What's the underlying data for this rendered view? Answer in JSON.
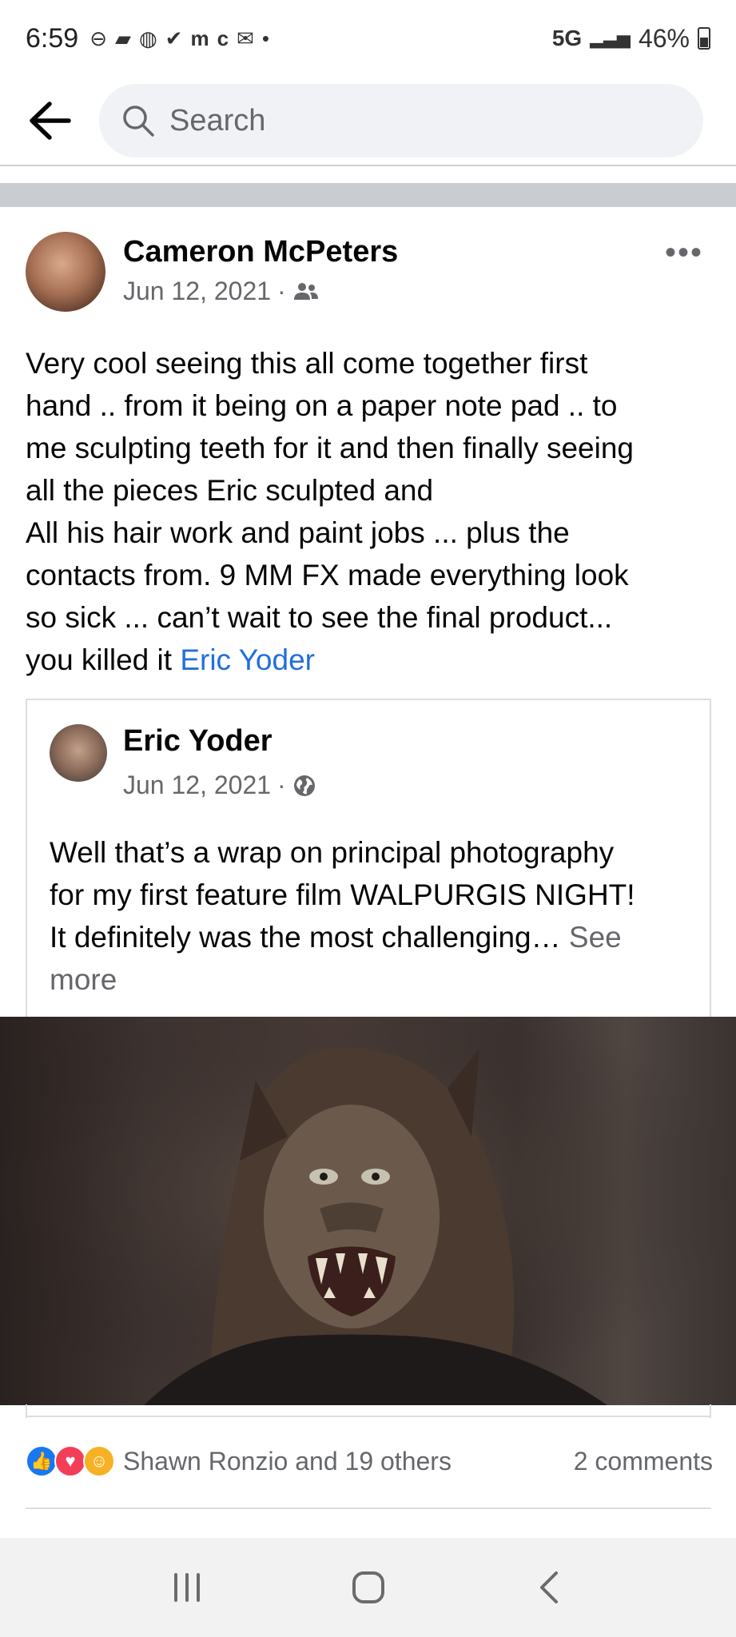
{
  "status_bar": {
    "time": "6:59",
    "network": "5G",
    "battery": "46%"
  },
  "search": {
    "placeholder": "Search"
  },
  "post": {
    "author": "Cameron McPeters",
    "date": "Jun 12, 2021",
    "audience_icon": "friends-icon",
    "text_lines": [
      "Very cool seeing this all come together first",
      "hand .. from it being on a paper note pad .. to",
      "me sculpting teeth for it and then finally seeing",
      "all the pieces Eric sculpted and",
      "All his hair work and paint jobs ... plus the",
      "contacts from. 9 MM FX made everything look",
      "so sick ...  can’t wait to see the final product...",
      "you killed it "
    ],
    "mention": "Eric Yoder"
  },
  "shared_post": {
    "author": "Eric Yoder",
    "date": "Jun 12, 2021",
    "audience_icon": "globe-icon",
    "text_lines": [
      "Well that’s a wrap on principal photography",
      "for my first feature film WALPURGIS NIGHT!",
      "It definitely was the most challenging… "
    ],
    "see_more": "See more"
  },
  "reactions": {
    "icons": [
      "like-icon",
      "love-icon",
      "care-icon"
    ],
    "summary": "Shawn Ronzio and 19 others",
    "comments": "2 comments"
  },
  "colors": {
    "link": "#216fdb",
    "secondary_text": "#65676b",
    "like": "#1877f2",
    "love": "#f33e58",
    "care": "#f7b125"
  }
}
